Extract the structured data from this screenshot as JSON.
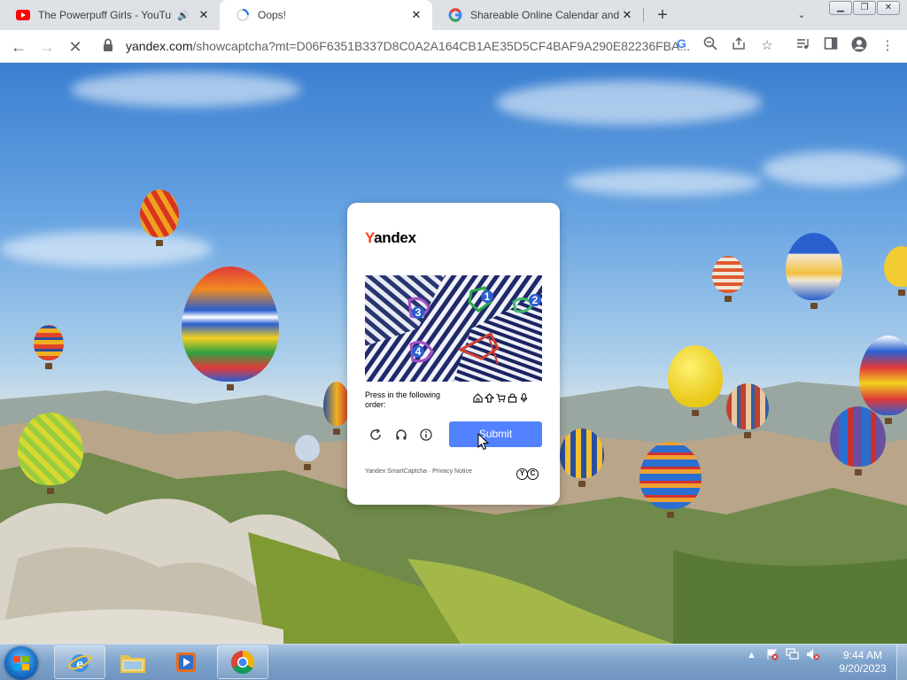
{
  "browser": {
    "tabs": [
      {
        "title": "The Powerpuff Girls - YouTub",
        "favicon": "youtube-icon",
        "audio": true,
        "active": false
      },
      {
        "title": "Oops!",
        "favicon": "loading-spinner-icon",
        "audio": false,
        "active": true
      },
      {
        "title": "Shareable Online Calendar and S",
        "favicon": "google-icon",
        "audio": false,
        "active": false
      }
    ],
    "address": {
      "host": "yandex.com",
      "path": "/showcaptcha?mt=D06F6351B337D8C0A2A164CB1AE35D5CF4BAF9A290E82236FBA..."
    }
  },
  "captcha": {
    "brand": {
      "first_letter": "Y",
      "rest": "andex"
    },
    "instruction": "Press in the following order:",
    "symbols": [
      "home-icon",
      "arrow-up-icon",
      "cart-icon",
      "lock-icon",
      "microphone-icon"
    ],
    "image_markers": [
      "1",
      "2",
      "3",
      "4"
    ],
    "submit_label": "Submit",
    "footer": "Yandex SmartCaptcha · Privacy Notice",
    "footer_logo": [
      "Y",
      "C"
    ]
  },
  "taskbar": {
    "apps": [
      "internet-explorer-icon",
      "file-explorer-icon",
      "media-player-icon",
      "chrome-icon"
    ],
    "clock": {
      "time": "9:44 AM",
      "date": "9/20/2023"
    }
  },
  "colors": {
    "accent": "#5282ff",
    "yandex_red": "#fc3f1d"
  }
}
